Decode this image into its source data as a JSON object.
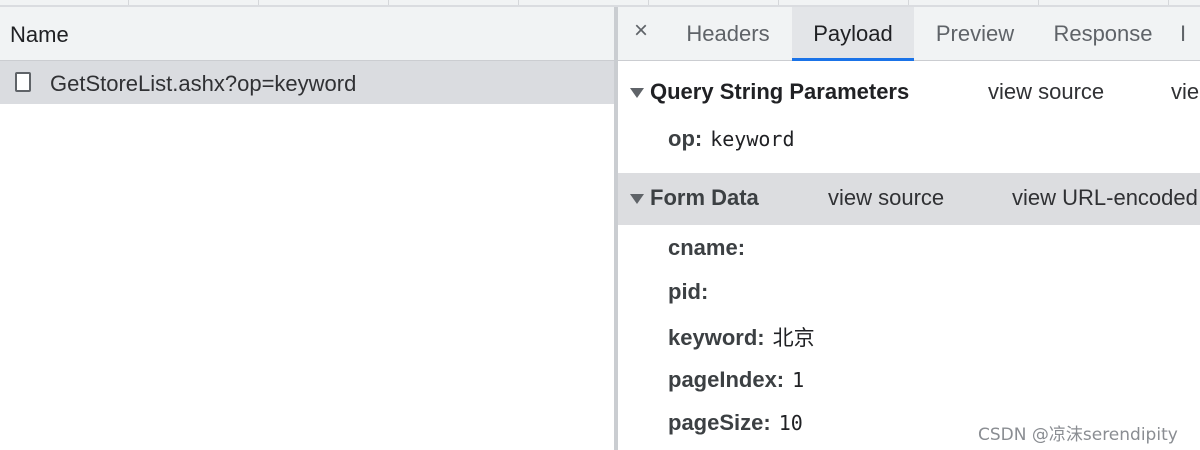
{
  "left_pane": {
    "column_header": "Name",
    "requests": [
      {
        "name": "GetStoreList.ashx?op=keyword"
      }
    ]
  },
  "right_pane": {
    "close_glyph": "×",
    "tabs": [
      {
        "label": "Headers",
        "active": false
      },
      {
        "label": "Payload",
        "active": true
      },
      {
        "label": "Preview",
        "active": false
      },
      {
        "label": "Response",
        "active": false
      },
      {
        "label": "I",
        "active": false
      }
    ],
    "query_section": {
      "title": "Query String Parameters",
      "links": [
        "view source",
        "vie"
      ],
      "params": [
        {
          "key": "op:",
          "value": "keyword"
        }
      ]
    },
    "form_section": {
      "title": "Form Data",
      "links": [
        "view source",
        "view URL-encoded"
      ],
      "params": [
        {
          "key": "cname:",
          "value": ""
        },
        {
          "key": "pid:",
          "value": ""
        },
        {
          "key": "keyword:",
          "value": "北京"
        },
        {
          "key": "pageIndex:",
          "value": "1"
        },
        {
          "key": "pageSize:",
          "value": "10"
        }
      ]
    }
  },
  "watermark": "CSDN @凉沫serendipity",
  "colors": {
    "accent": "#1a73e8",
    "header_bg": "#f1f3f4",
    "selected_row": "#dadce0",
    "section_bg": "#dcdde0"
  }
}
